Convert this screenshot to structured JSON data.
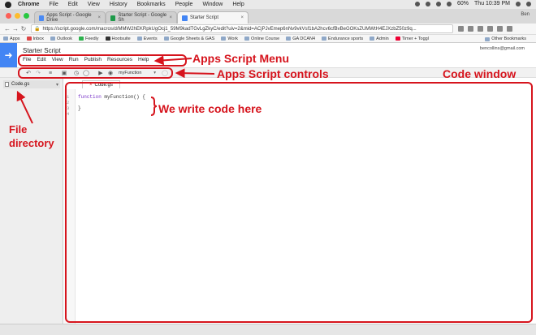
{
  "mac_menubar": {
    "app": "Chrome",
    "items": [
      "File",
      "Edit",
      "View",
      "History",
      "Bookmarks",
      "People",
      "Window",
      "Help"
    ],
    "battery": "60%",
    "clock": "Thu 10:39 PM"
  },
  "browser": {
    "tabs": [
      {
        "title": "Apps Script - Google Drive",
        "favicon_color": "#4a8af4",
        "active": false
      },
      {
        "title": "Starter Script - Google Sh",
        "favicon_color": "#1e9a4a",
        "active": false
      },
      {
        "title": "Starter Script",
        "favicon_color": "#4285f4",
        "active": true
      }
    ],
    "user_badge": "Ben",
    "url": "https://script.google.com/macros/d/MMW2hEKRpkUgOcj1_59M9kadTGvLgZkyC/edit?uiv=2&mid=ACjPJvEmep6nNv9vkVsf1bA2hcv6cfBvBeGOKsZUMWtH4EJXzbZ50z9q...",
    "bookmarks": [
      "Apps",
      "Inbox",
      "Outlook",
      "Feedly",
      "Hootsuite",
      "Events",
      "Google Sheets & GAS",
      "Work",
      "Online Course",
      "GA DCAN4",
      "Endurance sports",
      "Admin",
      "Timer + Toggl"
    ],
    "other_bookmarks": "Other Bookmarks"
  },
  "app": {
    "project_title": "Starter Script",
    "menu": [
      "File",
      "Edit",
      "View",
      "Run",
      "Publish",
      "Resources",
      "Help"
    ],
    "account_email": "bencollins@gmail.com"
  },
  "toolbar": {
    "function_select": "myFunction"
  },
  "sidebar": {
    "file": "Code.gs"
  },
  "editor": {
    "tab": "Code.gs",
    "line_numbers": [
      "1",
      "2",
      "3",
      "4"
    ],
    "code_line_1_keyword": "function",
    "code_line_1_rest": " myFunction() {",
    "code_line_3": "}"
  },
  "annotations": {
    "menu": "Apps Script Menu",
    "controls": "Apps Script controls",
    "code_window": "Code window",
    "write_code": "We write code here",
    "file_directory_1": "File",
    "file_directory_2": "directory"
  },
  "colors": {
    "annotation_red": "#d6141d",
    "apps_script_blue": "#4285f4",
    "keyword_purple": "#7a36c8"
  }
}
